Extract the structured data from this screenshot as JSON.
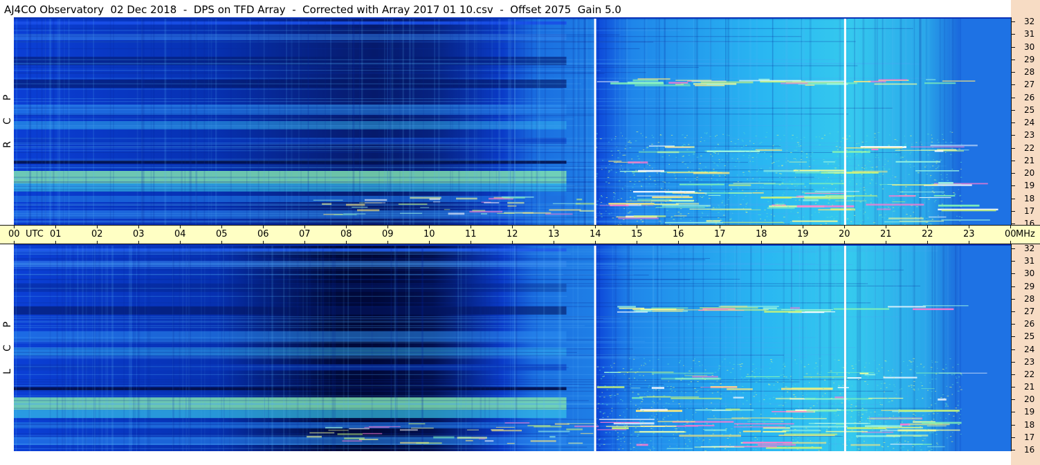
{
  "title": "AJ4CO Observatory  02 Dec 2018  -  DPS on TFD Array  -  Corrected with Array 2017 01 10.csv  -  Offset 2075  Gain 5.0",
  "time_axis": {
    "labels": [
      "00",
      "UTC",
      "01",
      "02",
      "03",
      "04",
      "05",
      "06",
      "07",
      "08",
      "09",
      "10",
      "11",
      "12",
      "13",
      "14",
      "15",
      "16",
      "17",
      "18",
      "19",
      "20",
      "21",
      "22",
      "23",
      "00",
      "MHz"
    ]
  },
  "freq_axis": {
    "labels": [
      "32",
      "31",
      "30",
      "29",
      "28",
      "27",
      "26",
      "25",
      "24",
      "23",
      "22",
      "21",
      "20",
      "19",
      "18",
      "17",
      "16"
    ]
  },
  "panels": [
    {
      "id": "rcp",
      "letters": [
        "R",
        "C",
        "P"
      ]
    },
    {
      "id": "lcp",
      "letters": [
        "L",
        "C",
        "P"
      ]
    }
  ],
  "colors": {
    "accent_time_axis": "#ffffc4",
    "accent_freq_axis": "#f7dcc4",
    "spectrogram_base": "#0a3fd0"
  }
}
